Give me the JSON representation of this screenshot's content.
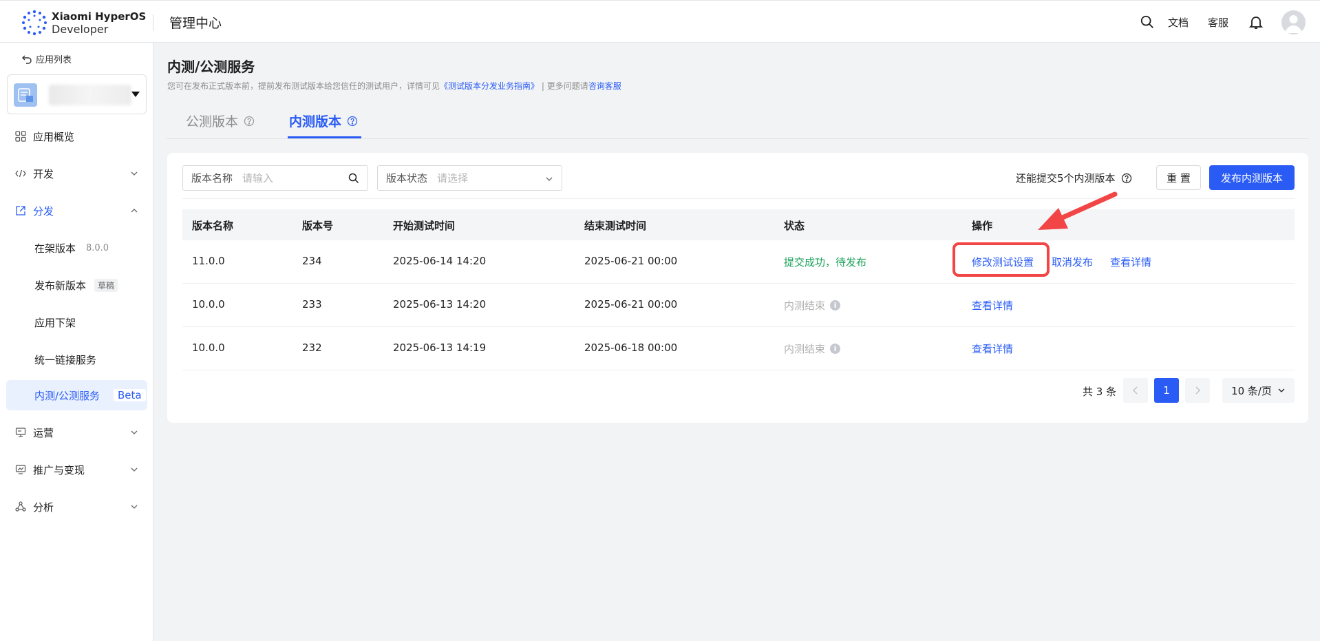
{
  "header": {
    "brand_line1": "Xiaomi HyperOS",
    "brand_line2": "Developer",
    "title": "管理中心",
    "docs": "文档",
    "service": "客服"
  },
  "sidebar": {
    "back": "应用列表",
    "items": [
      {
        "label": "应用概览"
      },
      {
        "label": "开发"
      },
      {
        "label": "分发"
      },
      {
        "label": "运营"
      },
      {
        "label": "推广与变现"
      },
      {
        "label": "分析"
      }
    ],
    "sub_items": [
      {
        "label": "在架版本",
        "meta": "8.0.0"
      },
      {
        "label": "发布新版本",
        "badge": "草稿"
      },
      {
        "label": "应用下架"
      },
      {
        "label": "统一链接服务"
      },
      {
        "label": "内测/公测服务",
        "badge": "Beta"
      }
    ]
  },
  "page": {
    "title": "内测/公测服务",
    "desc_prefix": "您可在发布正式版本前，提前发布测试版本给您信任的测试用户，详情可见",
    "desc_link": "《测试版本分发业务指南》",
    "desc_mid": " | 更多问题请",
    "desc_link2": "咨询客服"
  },
  "tabs": [
    {
      "label": "公测版本"
    },
    {
      "label": "内测版本"
    }
  ],
  "filters": {
    "name_label": "版本名称",
    "name_placeholder": "请输入",
    "status_label": "版本状态",
    "status_placeholder": "请选择"
  },
  "toolbar": {
    "quota": "还能提交5个内测版本",
    "reset": "重 置",
    "publish": "发布内测版本"
  },
  "table": {
    "columns": [
      "版本名称",
      "版本号",
      "开始测试时间",
      "结束测试时间",
      "状态",
      "操作"
    ],
    "rows": [
      {
        "name": "11.0.0",
        "code": "234",
        "start": "2025-06-14 14:20",
        "end": "2025-06-21 00:00",
        "status": "提交成功，待发布",
        "actions": [
          "修改测试设置",
          "取消发布",
          "查看详情"
        ]
      },
      {
        "name": "10.0.0",
        "code": "233",
        "start": "2025-06-13 14:20",
        "end": "2025-06-21 00:00",
        "status": "内测结束",
        "actions": [
          "查看详情"
        ]
      },
      {
        "name": "10.0.0",
        "code": "232",
        "start": "2025-06-13 14:19",
        "end": "2025-06-18 00:00",
        "status": "内测结束",
        "actions": [
          "查看详情"
        ]
      }
    ]
  },
  "pager": {
    "total": "共 3 条",
    "current": "1",
    "size": "10 条/页"
  },
  "colors": {
    "accent": "#2a5cf5",
    "success": "#18a058",
    "annotation": "#f24545"
  }
}
